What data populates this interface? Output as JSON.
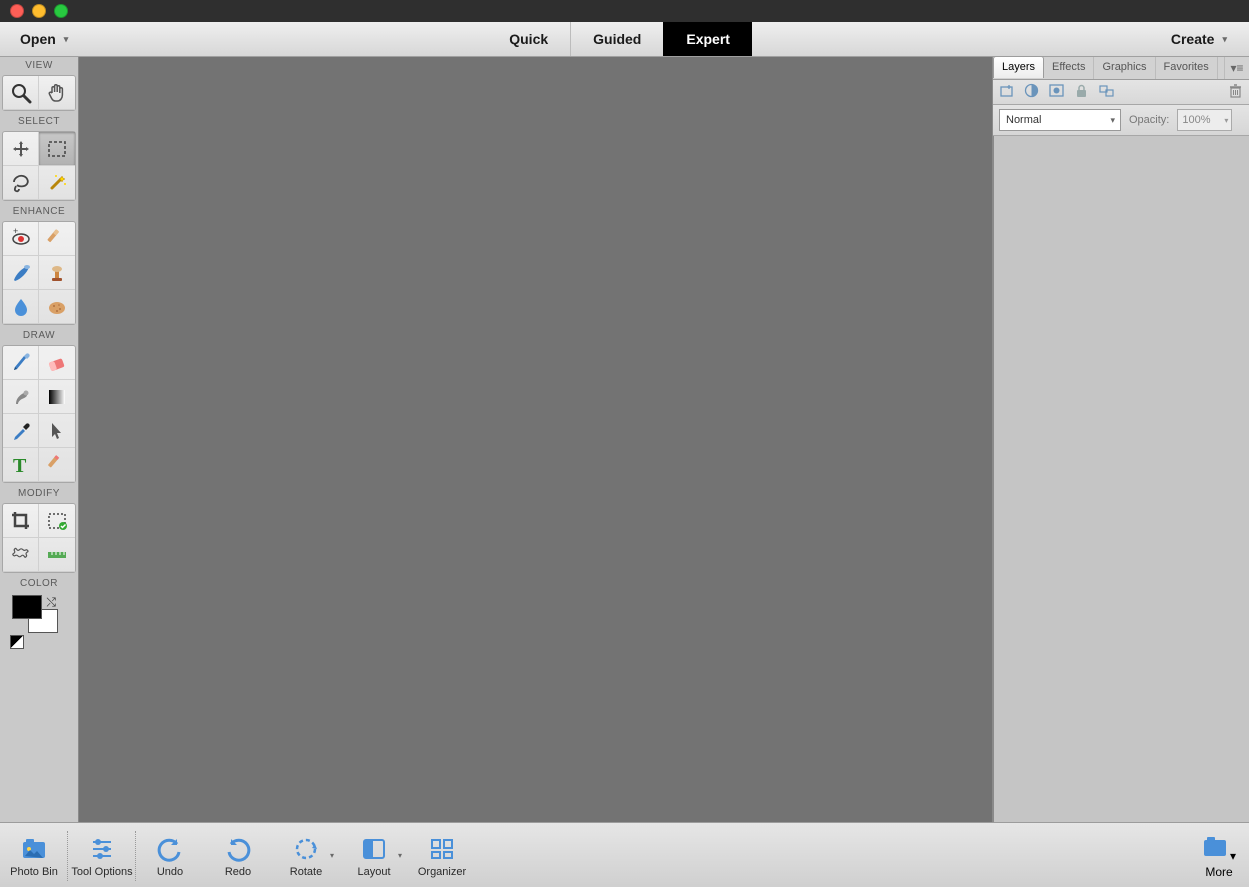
{
  "topbar": {
    "open": "Open",
    "create": "Create",
    "modes": [
      {
        "label": "Quick",
        "active": false
      },
      {
        "label": "Guided",
        "active": false
      },
      {
        "label": "Expert",
        "active": true
      }
    ]
  },
  "toolbar": {
    "groups": [
      {
        "header": "VIEW",
        "tools": [
          "zoom",
          "hand"
        ]
      },
      {
        "header": "SELECT",
        "tools": [
          "move",
          "marquee",
          "lasso",
          "magic-wand"
        ],
        "selected": "marquee"
      },
      {
        "header": "ENHANCE",
        "tools": [
          "redeye",
          "whiten",
          "brush-heal",
          "stamp",
          "blur",
          "sponge"
        ]
      },
      {
        "header": "DRAW",
        "tools": [
          "brush",
          "eraser",
          "smudge",
          "gradient",
          "eyedropper",
          "pointer",
          "type",
          "pencil"
        ]
      },
      {
        "header": "MODIFY",
        "tools": [
          "crop",
          "recompose",
          "cookie",
          "straighten"
        ]
      },
      {
        "header": "COLOR",
        "swatch": {
          "fg": "#000000",
          "bg": "#ffffff"
        }
      }
    ]
  },
  "rpanel": {
    "tabs": [
      {
        "label": "Layers",
        "active": true
      },
      {
        "label": "Effects"
      },
      {
        "label": "Graphics"
      },
      {
        "label": "Favorites"
      }
    ],
    "icons": [
      "new-layer",
      "adjustment",
      "mask",
      "lock",
      "link"
    ],
    "blend_mode": "Normal",
    "opacity_label": "Opacity:",
    "opacity_value": "100%"
  },
  "bottombar": {
    "items": [
      {
        "id": "photobin",
        "label": "Photo Bin",
        "sep": true
      },
      {
        "id": "tooloptions",
        "label": "Tool Options",
        "sep": true
      },
      {
        "id": "undo",
        "label": "Undo"
      },
      {
        "id": "redo",
        "label": "Redo"
      },
      {
        "id": "rotate",
        "label": "Rotate",
        "caret": true
      },
      {
        "id": "layout",
        "label": "Layout",
        "caret": true
      },
      {
        "id": "organizer",
        "label": "Organizer"
      }
    ],
    "more": "More"
  }
}
